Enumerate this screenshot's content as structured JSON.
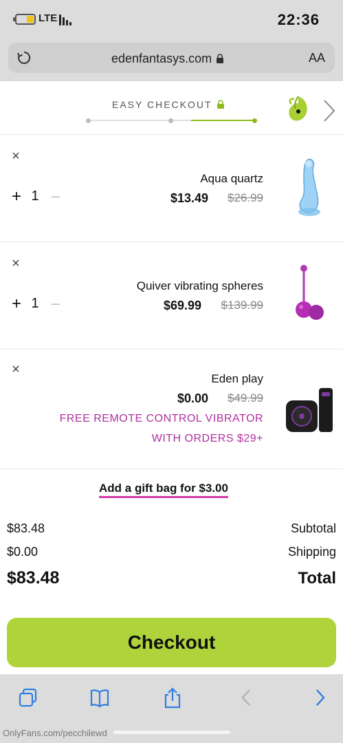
{
  "status_bar": {
    "time": "22:36",
    "network": "LTE"
  },
  "browser": {
    "url": "edenfantasys.com",
    "text_size_label": "AA"
  },
  "checkout_header": {
    "title": "EASY CHECKOUT",
    "steps_total": 3,
    "current_step": 3
  },
  "cart": {
    "items": [
      {
        "name": "Aqua quartz",
        "old_price": "$26.99",
        "price": "$13.49",
        "quantity": "1",
        "image": "clear-blue-dildo"
      },
      {
        "name": "Quiver vibrating spheres",
        "old_price": "$139.99",
        "price": "$69.99",
        "quantity": "1",
        "image": "purple-kegel-balls"
      },
      {
        "name": "Eden play",
        "old_price": "$49.99",
        "price": "$0.00",
        "promo_line1": "FREE REMOTE CONTROL VIBRATOR",
        "promo_line2": "WITH ORDERS $29+",
        "image": "black-remote-vibrator"
      }
    ]
  },
  "gift_bag": {
    "label": "Add a gift bag for $3.00"
  },
  "totals": {
    "subtotal_label": "Subtotal",
    "subtotal_value": "$83.48",
    "shipping_label": "Shipping",
    "shipping_value": "$0.00",
    "total_label": "Total",
    "total_value": "$83.48"
  },
  "checkout_button": {
    "label": "Checkout"
  },
  "toolbar": {
    "icons": [
      "tabs-icon",
      "bookmarks-icon",
      "share-icon",
      "back-icon",
      "forward-icon"
    ]
  },
  "watermark": "OnlyFans.com/pecchilewd",
  "colors": {
    "accent_green": "#afd43b",
    "promo_magenta": "#b0309e",
    "gift_underline": "#d43aa6",
    "toolbar_icon_blue": "#2f7de1"
  }
}
